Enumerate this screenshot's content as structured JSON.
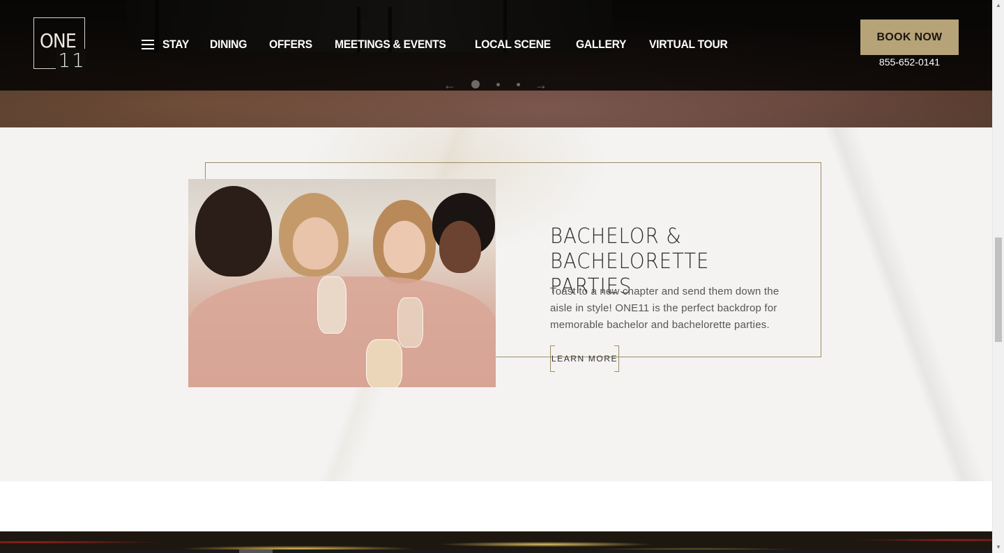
{
  "brand": {
    "logo_top": "ONE",
    "logo_bottom": "11"
  },
  "nav": {
    "items": [
      {
        "label": "STAY"
      },
      {
        "label": "DINING"
      },
      {
        "label": "OFFERS"
      },
      {
        "label": "MEETINGS & EVENTS"
      },
      {
        "label": "LOCAL SCENE"
      },
      {
        "label": "GALLERY"
      },
      {
        "label": "VIRTUAL TOUR"
      }
    ],
    "book_label": "BOOK NOW",
    "phone": "855-652-0141"
  },
  "slider": {
    "prev_icon": "←",
    "next_icon": "→",
    "dots": 3,
    "active": 0
  },
  "feature": {
    "title_line1": "BACHELOR &",
    "title_line2": "BACHELORETTE PARTIES",
    "description": "Toast to a new chapter and send them down the aisle in style! ONE11 is the perfect backdrop for memorable bachelor and bachelorette parties.",
    "cta_label": "LEARN MORE",
    "image_alt": "women toasting with champagne"
  },
  "colors": {
    "accent_gold": "#b6a378",
    "frame_gold": "#a08b62",
    "header_bg": "#000000",
    "marble_bg": "#f4f3f2"
  },
  "icons": {
    "menu": "hamburger-icon",
    "prev": "arrow-left-icon",
    "next": "arrow-right-icon"
  }
}
